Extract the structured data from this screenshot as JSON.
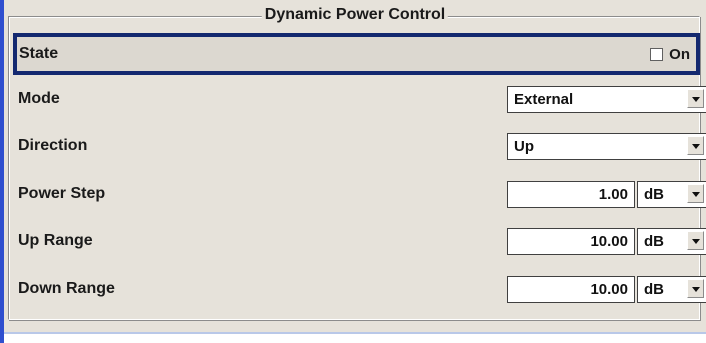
{
  "panel": {
    "title": "Dynamic Power Control"
  },
  "state": {
    "label": "State",
    "checkbox_label": "On",
    "checked": false
  },
  "mode": {
    "label": "Mode",
    "value": "External"
  },
  "direction": {
    "label": "Direction",
    "value": "Up"
  },
  "power_step": {
    "label": "Power Step",
    "value": "1.00",
    "unit": "dB"
  },
  "up_range": {
    "label": "Up Range",
    "value": "10.00",
    "unit": "dB"
  },
  "down_range": {
    "label": "Down Range",
    "value": "10.00",
    "unit": "dB"
  },
  "colors": {
    "panel_bg": "#e6e2da",
    "focus_border": "#13286f",
    "edge_accent": "#2f4fcf"
  }
}
